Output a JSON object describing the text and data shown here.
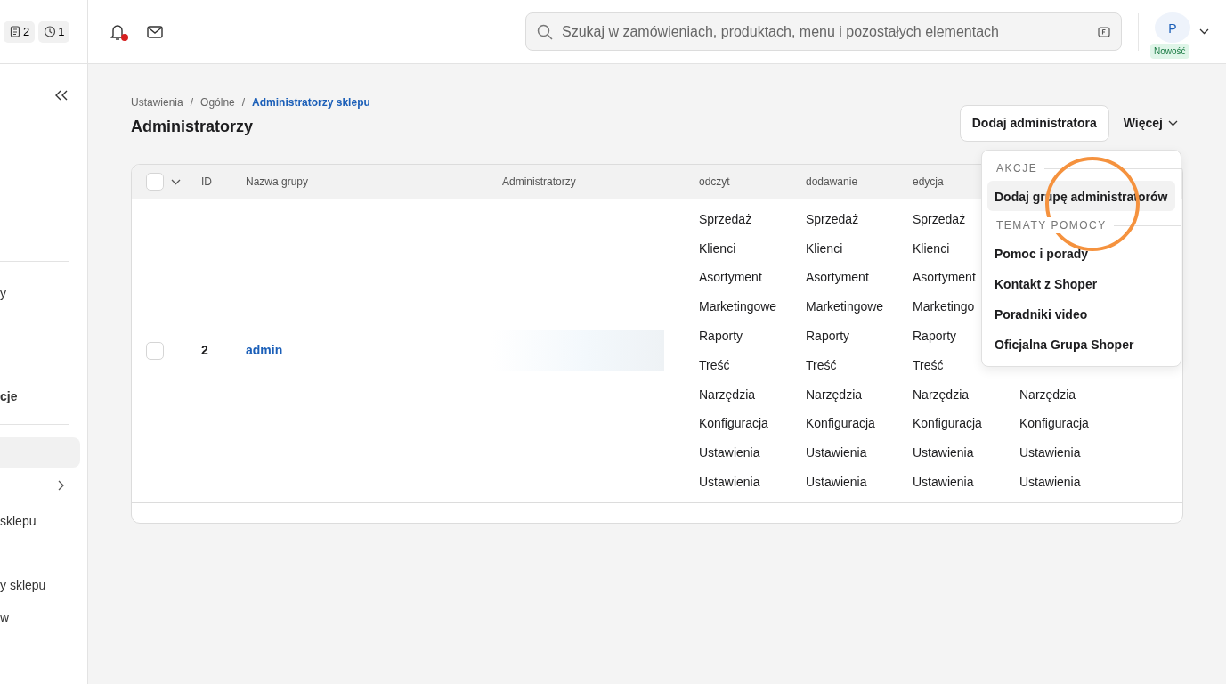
{
  "top_bar": {
    "counters": [
      {
        "kind": "clipboard",
        "count": "2"
      },
      {
        "kind": "clock",
        "count": "1"
      }
    ],
    "notifications": {
      "unread": true
    },
    "search": {
      "placeholder": "Szukaj w zamówieniach, produktach, menu i pozostałych elementach"
    },
    "avatar": {
      "initial": "P",
      "badge": "Nowość"
    }
  },
  "sidebar": {
    "items": [
      {
        "kind": "divider"
      },
      {
        "kind": "text",
        "label": "y",
        "bold": false
      },
      {
        "kind": "text",
        "label": "cje",
        "bold": true
      },
      {
        "kind": "divider"
      },
      {
        "kind": "blank",
        "selected": true
      },
      {
        "kind": "chevron",
        "selected": false
      },
      {
        "kind": "text",
        "label": "sklepu",
        "bold": false
      },
      {
        "kind": "text",
        "label": "y sklepu",
        "bold": false
      },
      {
        "kind": "text",
        "label": "w",
        "bold": false
      }
    ]
  },
  "breadcrumb": {
    "separator": "/",
    "items": [
      {
        "label": "Ustawienia",
        "current": false
      },
      {
        "label": "Ogólne",
        "current": false
      },
      {
        "label": "Administratorzy sklepu",
        "current": true
      }
    ]
  },
  "page_title": "Administratorzy",
  "actions": {
    "primary": "Dodaj administratora",
    "more": "Więcej"
  },
  "table": {
    "columns": [
      "ID",
      "Nazwa grupy",
      "Administratorzy",
      "odczyt",
      "dodawanie",
      "edycja"
    ],
    "select_all_checked": false,
    "rows": [
      {
        "checked": false,
        "id": "2",
        "name": "admin",
        "administrators_redacted": true,
        "permissions": [
          {
            "odczyt": "Sprzedaż",
            "dodawanie": "Sprzedaż",
            "edycja": "Sprzedaż"
          },
          {
            "odczyt": "Klienci",
            "dodawanie": "Klienci",
            "edycja": "Klienci"
          },
          {
            "odczyt": "Asortyment",
            "dodawanie": "Asortyment",
            "edycja": "Asortyment"
          },
          {
            "odczyt": "Marketingowe",
            "dodawanie": "Marketingowe",
            "edycja": "Marketingo"
          },
          {
            "odczyt": "Raporty",
            "dodawanie": "Raporty",
            "edycja": "Raporty"
          },
          {
            "odczyt": "Treść",
            "dodawanie": "Treść",
            "edycja": "Treść"
          },
          {
            "odczyt": "Narzędzia",
            "dodawanie": "Narzędzia",
            "edycja": "Narzędzia",
            "column_4": "Narzędzia"
          },
          {
            "odczyt": "Konfiguracja",
            "dodawanie": "Konfiguracja",
            "edycja": "Konfiguracja",
            "column_4": "Konfiguracja"
          },
          {
            "odczyt": "Ustawienia",
            "dodawanie": "Ustawienia",
            "edycja": "Ustawienia",
            "column_4": "Ustawienia"
          },
          {
            "odczyt": "Ustawienia",
            "dodawanie": "Ustawienia",
            "edycja": "Ustawienia",
            "column_4": "Ustawienia"
          }
        ]
      }
    ]
  },
  "dropdown": {
    "sections": [
      {
        "heading": "AKCJE",
        "items": [
          {
            "label": "Dodaj grupę administratorów",
            "hovered": true
          }
        ]
      },
      {
        "heading": "TEMATY POMOCY",
        "items": [
          {
            "label": "Pomoc i porady",
            "hovered": false
          },
          {
            "label": "Kontakt z Shoper",
            "hovered": false
          },
          {
            "label": "Poradniki video",
            "hovered": false
          },
          {
            "label": "Oficjalna Grupa Shoper",
            "hovered": false
          }
        ]
      }
    ]
  },
  "highlight": {
    "shown": true
  }
}
